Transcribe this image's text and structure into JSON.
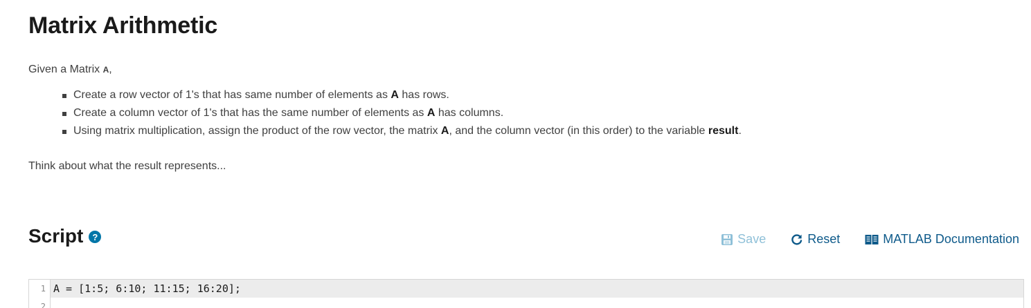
{
  "problem": {
    "title": "Matrix Arithmetic",
    "intro_prefix": "Given a Matrix ",
    "intro_var": "A",
    "intro_suffix": ",",
    "tasks": [
      {
        "pre": "Create a row vector of 1's that has same number of elements as ",
        "bold": "A",
        "post": " has rows."
      },
      {
        "pre": "Create a column vector of 1's that has the same number of elements as ",
        "bold": "A",
        "post": " has columns."
      },
      {
        "pre": "Using matrix multiplication, assign the product of the row vector, the matrix ",
        "bold": "A",
        "mid": ", and the column vector (in this order) to the variable ",
        "bold2": "result",
        "post": "."
      }
    ],
    "outro": "Think about what the result represents..."
  },
  "script": {
    "heading": "Script",
    "help_icon": "question-circle-icon",
    "toolbar": {
      "save_label": "Save",
      "save_icon": "floppy-disk-icon",
      "reset_label": "Reset",
      "reset_icon": "refresh-icon",
      "doc_label": "MATLAB Documentation",
      "doc_icon": "book-icon"
    },
    "lines": [
      {
        "number": "1",
        "code": "A = [1:5; 6:10; 11:15; 16:20];"
      },
      {
        "number": "2",
        "code": ""
      }
    ]
  },
  "colors": {
    "accent": "#0e5a8a",
    "help_icon": "#0076a8",
    "disabled": "#8fc0d8"
  }
}
